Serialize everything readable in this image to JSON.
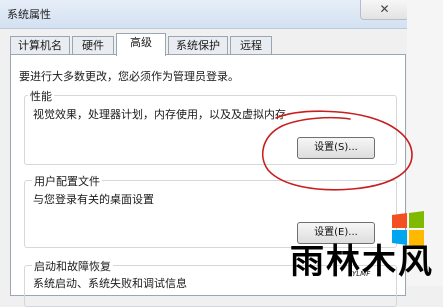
{
  "window": {
    "title": "系统属性",
    "close_glyph": "✕"
  },
  "tabs": [
    {
      "label": "计算机名",
      "active": false
    },
    {
      "label": "硬件",
      "active": false
    },
    {
      "label": "高级",
      "active": true
    },
    {
      "label": "系统保护",
      "active": false
    },
    {
      "label": "远程",
      "active": false
    }
  ],
  "admin_note": "要进行大多数更改，您必须作为管理员登录。",
  "performance": {
    "title": "性能",
    "description": "视觉效果，处理器计划，内存使用，以及及虚拟内存",
    "button": "设置(S)..."
  },
  "user_profiles": {
    "title": "用户配置文件",
    "description": "与您登录有关的桌面设置",
    "button": "设置(E)..."
  },
  "startup_recovery": {
    "title": "启动和故障恢复",
    "description": "系统启动、系统失败和调试信息"
  },
  "watermark": {
    "text": "雨林木风",
    "subtext": "YLMF"
  },
  "colors": {
    "annotation_red": "#c81e1e",
    "logo_red": "#f25022",
    "logo_green": "#7fba00",
    "logo_blue": "#00a4ef",
    "logo_yellow": "#ffb900"
  },
  "icons": [
    "close-icon",
    "windows-logo-icon"
  ]
}
